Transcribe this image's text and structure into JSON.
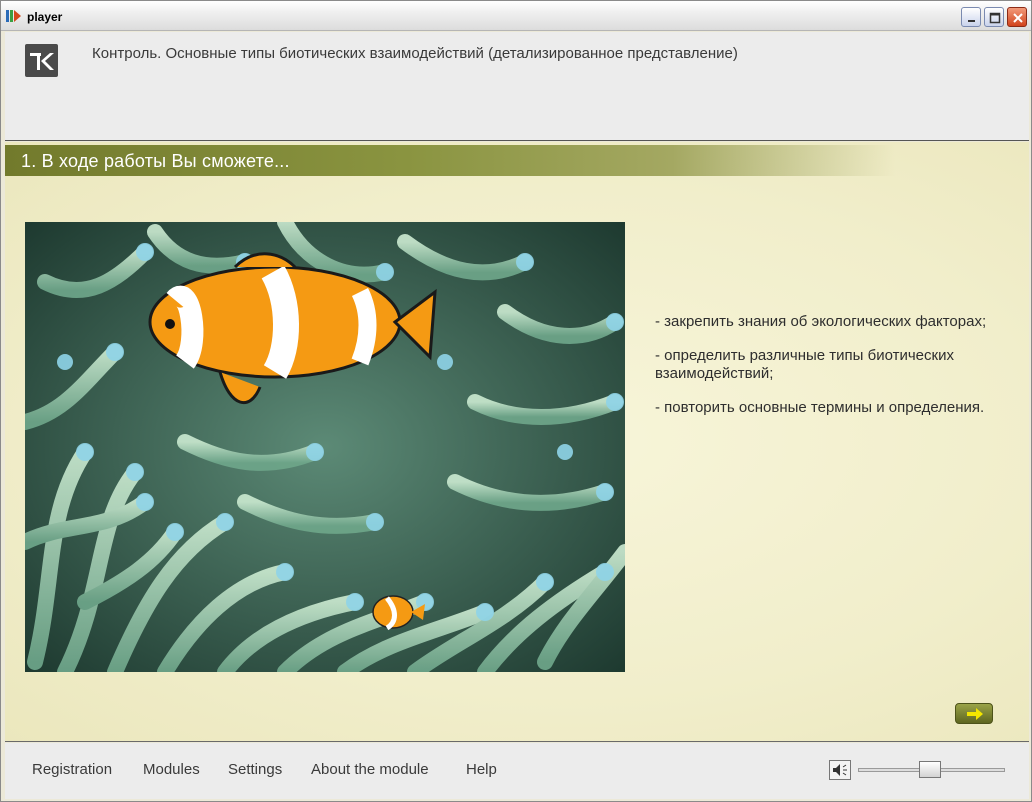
{
  "window": {
    "title": "player",
    "icon": "player-app-icon",
    "controls": [
      "minimize-icon",
      "maximize-icon",
      "close-icon"
    ]
  },
  "header": {
    "logo_icon": "k-logo-icon",
    "title": "Контроль. Основные типы биотических взаимодействий (детализированное представление)"
  },
  "section": {
    "title": "1. В ходе работы Вы сможете..."
  },
  "image": {
    "subject": "clownfish-in-sea-anemone"
  },
  "goals": [
    "- закрепить знания об экологических факторах;",
    "- определить различные типы биотических взаимодействий;",
    "- повторить основные термины и определения."
  ],
  "navigation": {
    "next_icon": "arrow-right-icon"
  },
  "menu": {
    "items": [
      "Registration",
      "Modules",
      "Settings",
      "About the module",
      "Help"
    ]
  },
  "volume": {
    "icon": "speaker-icon",
    "level": 0.5
  },
  "colors": {
    "section_bar": "#7a8232",
    "content_bg": "#f2efcc",
    "accent_arrow": "#f3e600"
  }
}
